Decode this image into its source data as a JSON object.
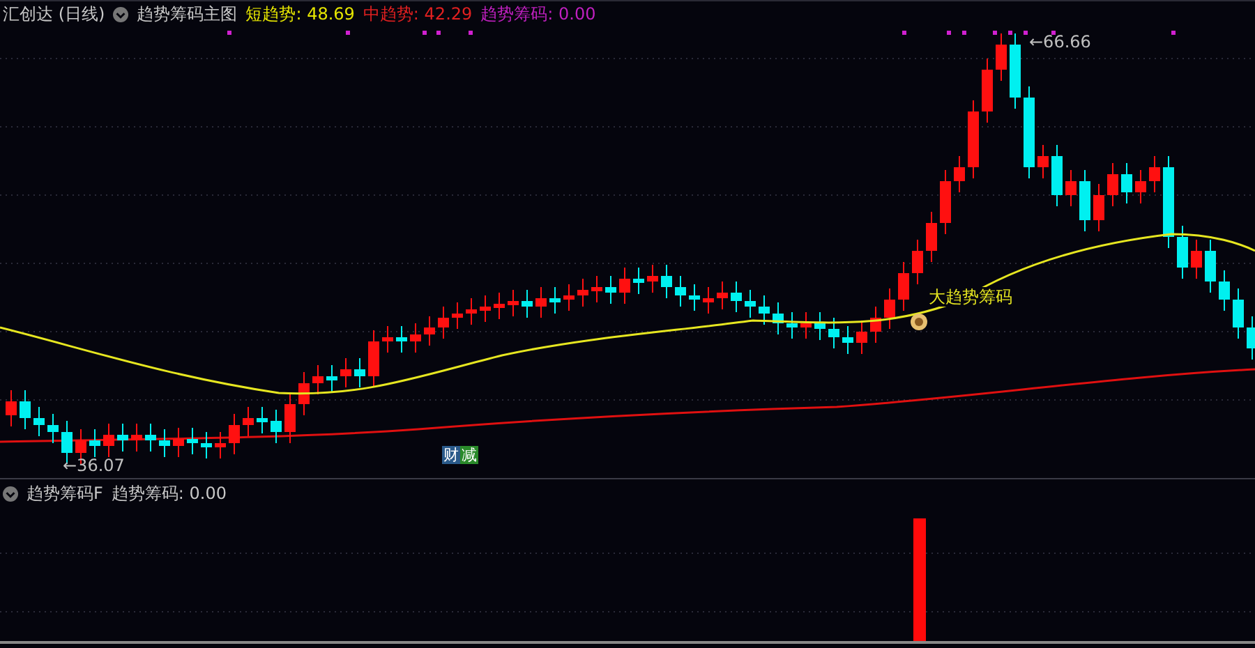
{
  "header": {
    "stock": "汇创达 (日线)",
    "indicator": "趋势筹码主图",
    "values": [
      {
        "label": "短趋势:",
        "value": "48.69",
        "color": "#e6e600"
      },
      {
        "label": "中趋势:",
        "value": "42.29",
        "color": "#e02020"
      },
      {
        "label": "趋势筹码:",
        "value": "0.00",
        "color": "#c020c0"
      }
    ]
  },
  "annotations": {
    "high": "←66.66",
    "low": "←36.07",
    "signal": "大趋势筹码",
    "tags": [
      {
        "text": "财",
        "color": "#2a5a8a"
      },
      {
        "text": "减",
        "color": "#2a8a2a"
      }
    ]
  },
  "sub_panel": {
    "indicator": "趋势筹码F",
    "values": [
      {
        "label": "趋势筹码:",
        "value": "0.00"
      }
    ]
  }
}
